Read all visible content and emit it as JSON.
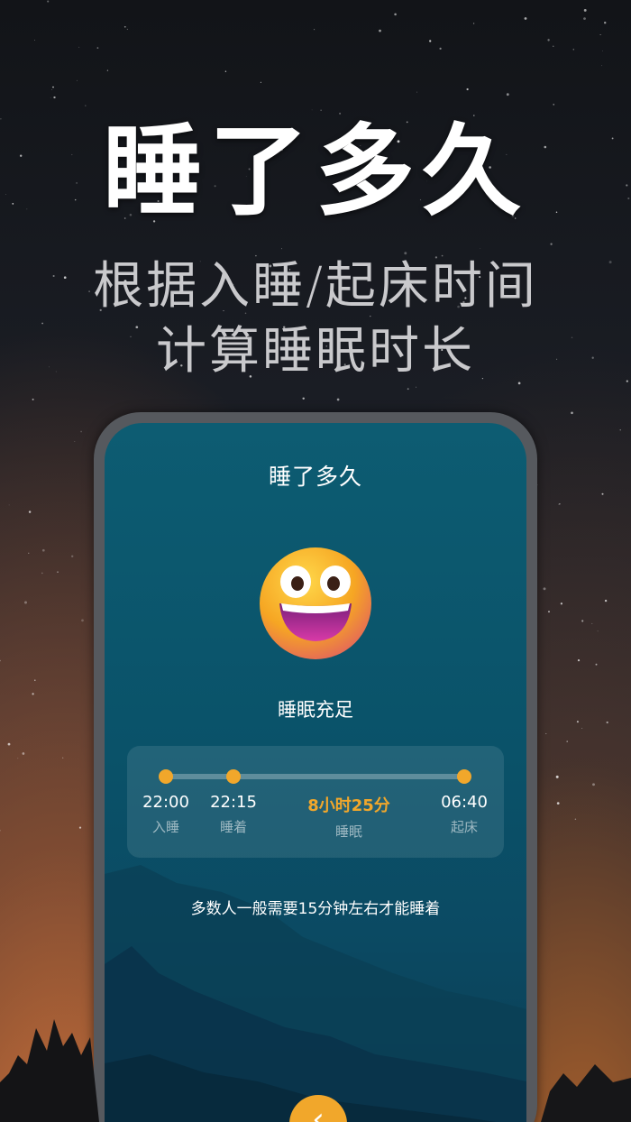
{
  "headline": "睡了多久",
  "subheadline": {
    "line1": "根据入睡/起床时间",
    "line2": "计算睡眠时长"
  },
  "phone": {
    "title": "睡了多久",
    "emoji_icon": "grinning-face-emoji",
    "status": "睡眠充足",
    "timeline": {
      "points": [
        {
          "time": "22:00",
          "label": "入睡"
        },
        {
          "time": "22:15",
          "label": "睡着"
        },
        {
          "time": "8小时25分",
          "label": "睡眠"
        },
        {
          "time": "06:40",
          "label": "起床"
        }
      ]
    },
    "hint": "多数人一般需要15分钟左右才能睡着",
    "back_icon": "chevron-left-icon"
  },
  "colors": {
    "accent": "#f1a72b",
    "screen_bg": "#0b4a63"
  }
}
